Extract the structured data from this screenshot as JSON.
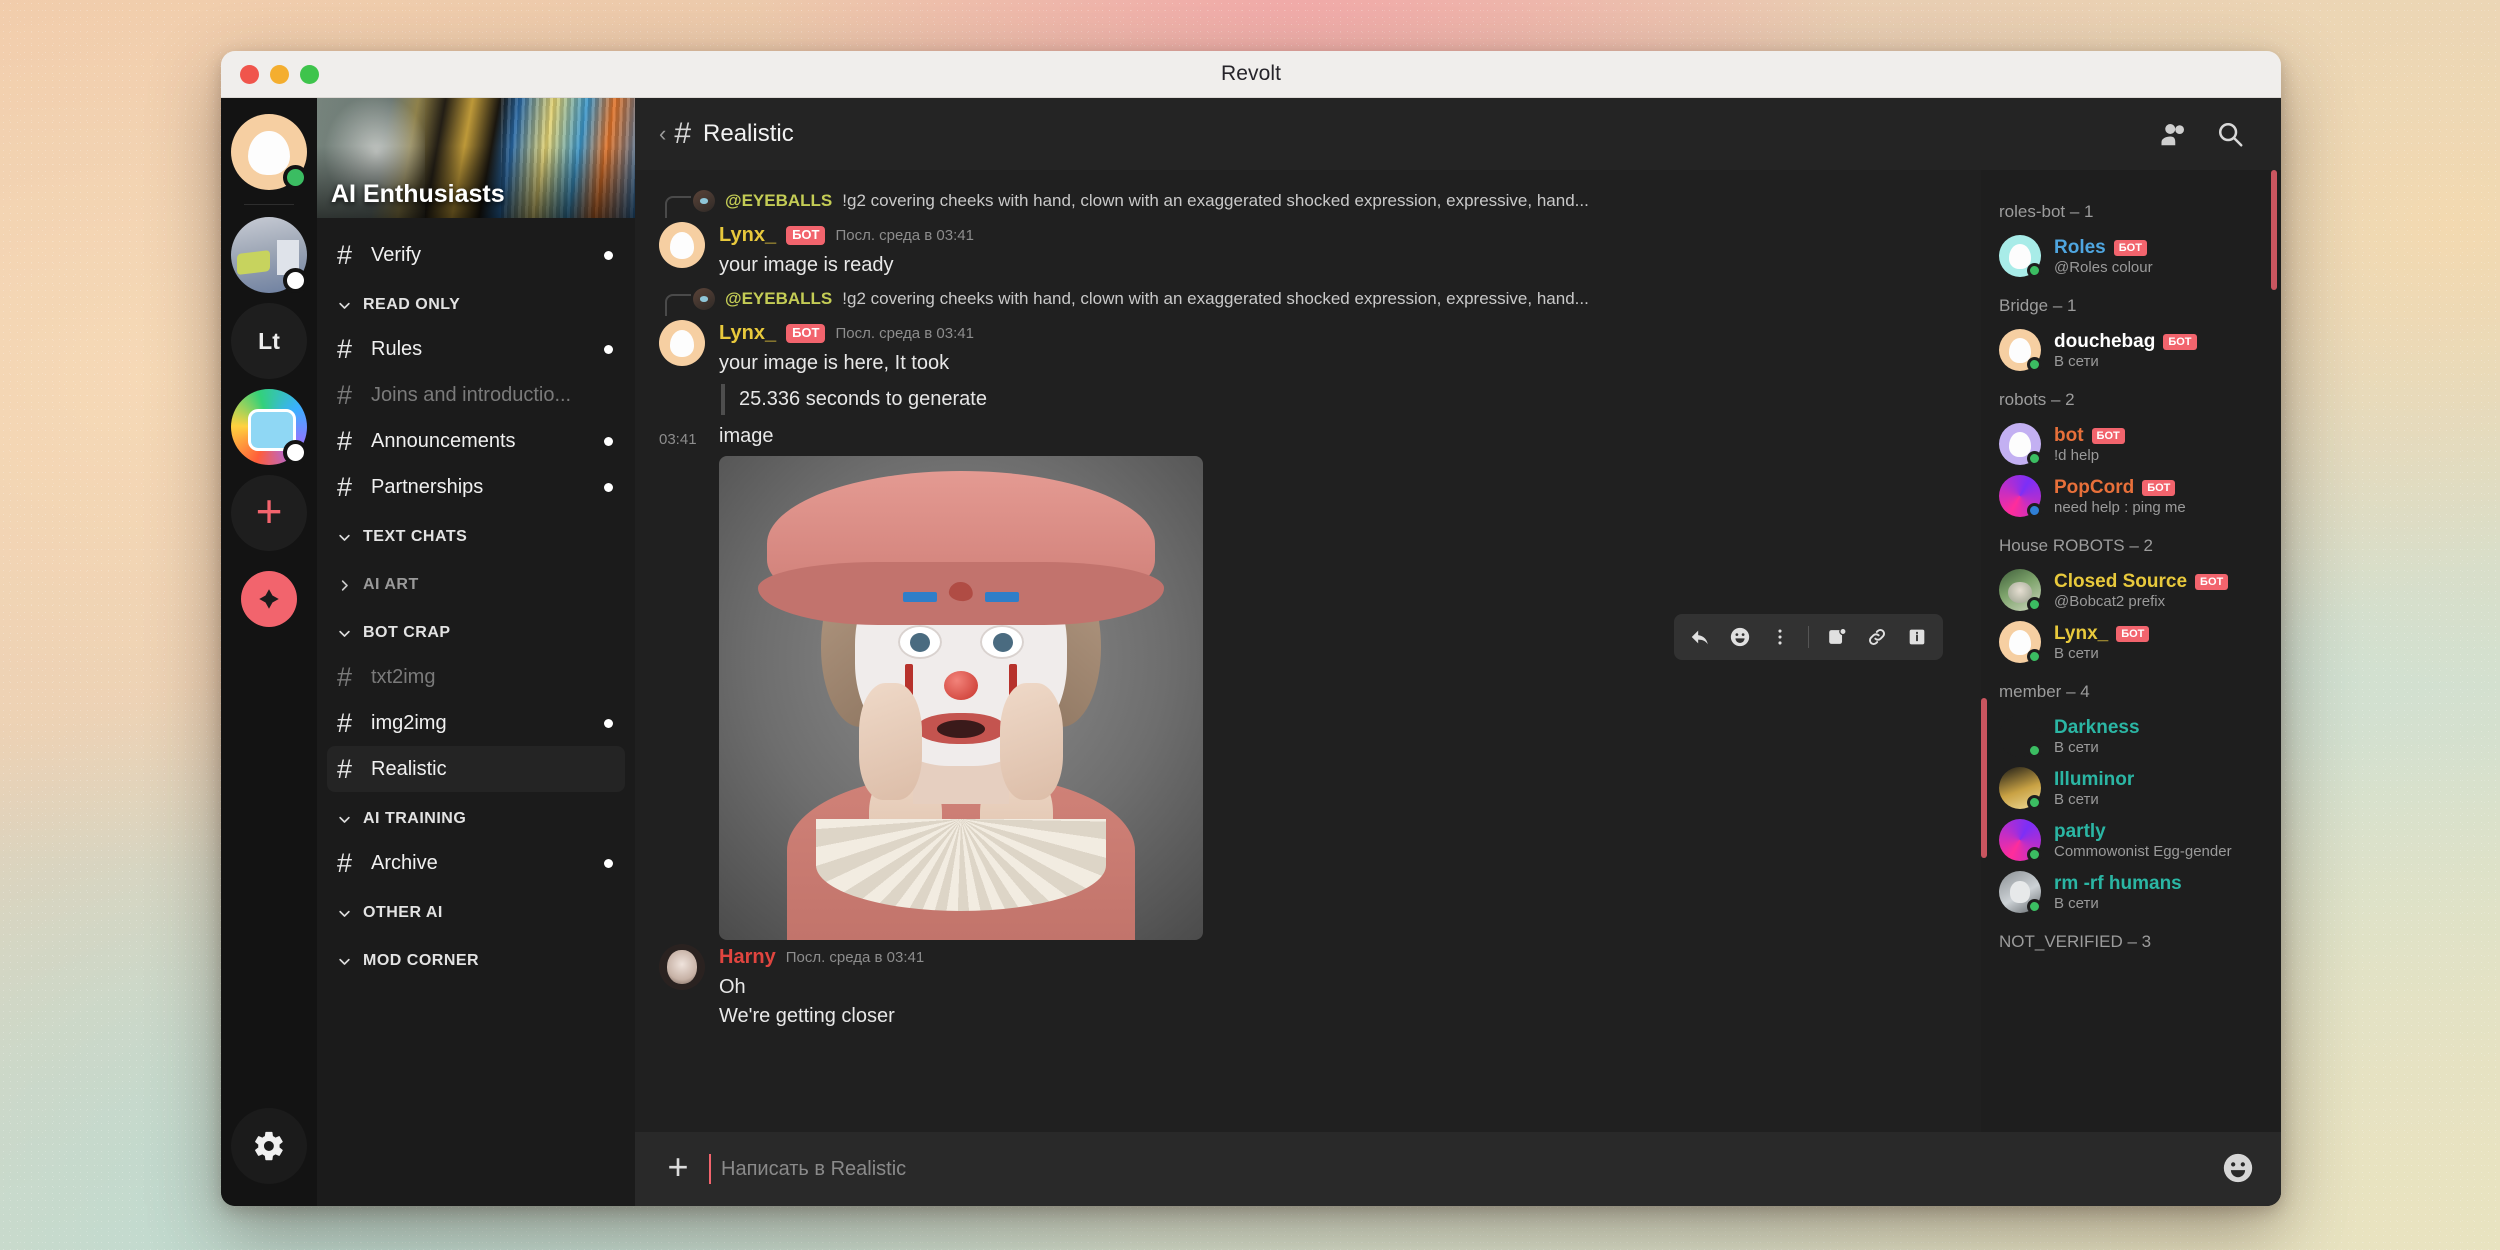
{
  "window": {
    "title": "Revolt"
  },
  "rail": {
    "items": [
      {
        "name": "user-avatar",
        "presence": "online"
      },
      {
        "name": "server-room",
        "presence": "idle"
      },
      {
        "name": "server-lt",
        "label": "Lt"
      },
      {
        "name": "server-bot",
        "presence": "idle"
      },
      {
        "name": "add-server",
        "label": "+"
      },
      {
        "name": "discover",
        "label": ""
      }
    ],
    "settings_label": "Settings"
  },
  "server": {
    "name": "AI Enthusiasts",
    "channels": [
      {
        "type": "channel",
        "label": "Verify",
        "unread": true,
        "muted": false,
        "active": false
      },
      {
        "type": "category",
        "label": "READ ONLY",
        "collapsed": false
      },
      {
        "type": "channel",
        "label": "Rules",
        "unread": true,
        "muted": false,
        "active": false
      },
      {
        "type": "channel",
        "label": "Joins and introductio...",
        "unread": false,
        "muted": true,
        "active": false
      },
      {
        "type": "channel",
        "label": "Announcements",
        "unread": true,
        "muted": false,
        "active": false
      },
      {
        "type": "channel",
        "label": "Partnerships",
        "unread": true,
        "muted": false,
        "active": false
      },
      {
        "type": "category",
        "label": "TEXT CHATS",
        "collapsed": false
      },
      {
        "type": "category",
        "label": "AI ART",
        "collapsed": true
      },
      {
        "type": "category",
        "label": "BOT CRAP",
        "collapsed": false
      },
      {
        "type": "channel",
        "label": "txt2img",
        "unread": false,
        "muted": true,
        "active": false
      },
      {
        "type": "channel",
        "label": "img2img",
        "unread": true,
        "muted": false,
        "active": false
      },
      {
        "type": "channel",
        "label": "Realistic",
        "unread": false,
        "muted": false,
        "active": true
      },
      {
        "type": "category",
        "label": "AI TRAINING",
        "collapsed": false
      },
      {
        "type": "channel",
        "label": "Archive",
        "unread": true,
        "muted": false,
        "active": false
      },
      {
        "type": "category",
        "label": "OTHER AI",
        "collapsed": false
      },
      {
        "type": "category",
        "label": "MOD CORNER",
        "collapsed": false
      }
    ]
  },
  "header": {
    "channel": "Realistic",
    "hash": "#",
    "back": "‹",
    "members_icon": "members-icon",
    "search_icon": "search-icon"
  },
  "messages": [
    {
      "reply": {
        "author": "@EYEBALLS",
        "text": "!g2 covering cheeks with hand, clown with an exaggerated shocked expression, expressive, hand..."
      },
      "author": "Lynx_",
      "author_color": "#e8c93c",
      "badge": "БОТ",
      "time": "Посл. среда в 03:41",
      "lines": [
        "your image is ready"
      ]
    },
    {
      "reply": {
        "author": "@EYEBALLS",
        "text": "!g2 covering cheeks with hand, clown with an exaggerated shocked expression, expressive, hand..."
      },
      "author": "Lynx_",
      "author_color": "#e8c93c",
      "badge": "БОТ",
      "time": "Посл. среда в 03:41",
      "lines": [
        "your image is here, It took"
      ],
      "quote": "25.336 seconds to generate",
      "attachment": {
        "time": "03:41",
        "name": "image",
        "alt": "clown-with-shocked-expression"
      }
    },
    {
      "author": "Harny",
      "author_color": "#e0453f",
      "time": "Посл. среда в 03:41",
      "lines": [
        "Oh",
        "We're getting closer"
      ]
    }
  ],
  "message_toolbar": {
    "buttons": [
      {
        "name": "reply-icon",
        "label": "Reply"
      },
      {
        "name": "add-reaction-icon",
        "label": "React"
      },
      {
        "name": "more-options-icon",
        "label": "More"
      },
      {
        "name": "mark-unread-icon",
        "label": "Mark unread"
      },
      {
        "name": "copy-link-icon",
        "label": "Copy link"
      },
      {
        "name": "info-icon",
        "label": "Info"
      }
    ]
  },
  "composer": {
    "placeholder": "Написать в Realistic",
    "value": "",
    "add_label": "+",
    "emoji_icon": "emoji-icon"
  },
  "members": {
    "groups": [
      {
        "title": "roles-bot – 1",
        "items": [
          {
            "name": "Roles",
            "color": "#4fa6e0",
            "badge": "БОТ",
            "status": "@Roles colour",
            "presence": "online",
            "avatar": "a-cyan blob"
          }
        ]
      },
      {
        "title": "Bridge – 1",
        "items": [
          {
            "name": "douchebag",
            "color": "#ffffff",
            "badge": "БОТ",
            "status": "В сети",
            "presence": "online",
            "avatar": "a-peach blob"
          }
        ]
      },
      {
        "title": "robots – 2",
        "items": [
          {
            "name": "bot",
            "color": "#e8703a",
            "badge": "БОТ",
            "status": "!d help",
            "presence": "online",
            "avatar": "a-purple blob"
          },
          {
            "name": "PopCord",
            "color": "#e8703a",
            "badge": "БОТ",
            "status": "need help : ping me",
            "presence": "busy",
            "avatar": "a-pinkmulti"
          }
        ]
      },
      {
        "title": "House ROBOTS – 2",
        "items": [
          {
            "name": "Closed Source",
            "color": "#e8c93c",
            "badge": "БОТ",
            "status": "@Bobcat2 prefix",
            "presence": "online",
            "avatar": "a-cat"
          },
          {
            "name": "Lynx_",
            "color": "#e8c93c",
            "badge": "БОТ",
            "status": "В сети",
            "presence": "online",
            "avatar": "a-peach blob"
          }
        ]
      },
      {
        "title": "member – 4",
        "items": [
          {
            "name": "Darkness",
            "color": "#2bb6a4",
            "badge": "",
            "status": "В сети",
            "presence": "online",
            "avatar": "a-dark"
          },
          {
            "name": "Illuminor",
            "color": "#2bb6a4",
            "badge": "",
            "status": "В сети",
            "presence": "online",
            "avatar": "a-gold"
          },
          {
            "name": "partly",
            "color": "#2bb6a4",
            "badge": "",
            "status": "Commowonist Egg-gender",
            "presence": "online",
            "avatar": "a-pinkmulti"
          },
          {
            "name": "rm -rf humans",
            "color": "#2bb6a4",
            "badge": "",
            "status": "В сети",
            "presence": "online",
            "avatar": "a-skull"
          }
        ]
      },
      {
        "title": "NOT_VERIFIED – 3",
        "items": []
      }
    ]
  },
  "colors": {
    "accent": "#f2646d",
    "bot_badge": "#f2646d",
    "online": "#3bbd62",
    "busy": "#2f7fd6",
    "bg_dark": "#1b1b1b",
    "bg_main": "#202020"
  }
}
